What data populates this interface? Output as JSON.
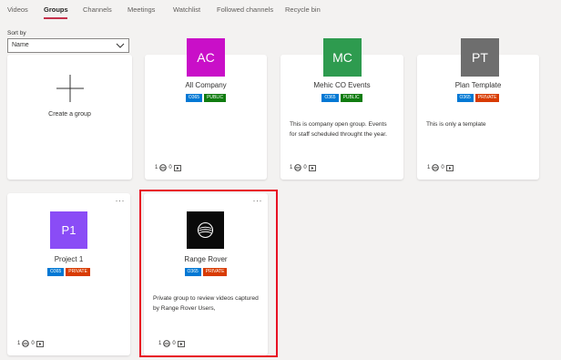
{
  "tabs": [
    "Videos",
    "Groups",
    "Channels",
    "Meetings",
    "Watchlist",
    "Followed channels",
    "Recycle bin"
  ],
  "sort": {
    "label": "Sort by",
    "value": "Name"
  },
  "create": {
    "label": "Create a group"
  },
  "groups": [
    {
      "initials": "AC",
      "name": "All Company",
      "badges": [
        "O365",
        "PUBLIC"
      ],
      "description": "",
      "members": "1",
      "videos": "0",
      "color": "#c90fc8"
    },
    {
      "initials": "MC",
      "name": "Mehic CO Events",
      "badges": [
        "O365",
        "PUBLIC"
      ],
      "description": "This is company open group. Events for staff scheduled throught the year.",
      "members": "1",
      "videos": "0",
      "color": "#2e9b4f"
    },
    {
      "initials": "PT",
      "name": "Plan Template",
      "badges": [
        "O365",
        "PRIVATE"
      ],
      "description": "This is only a template",
      "members": "1",
      "videos": "0",
      "color": "#6e6e6e"
    },
    {
      "initials": "P1",
      "name": "Project 1",
      "badges": [
        "O365",
        "PRIVATE"
      ],
      "description": "",
      "members": "1",
      "videos": "0",
      "color": "#8a4cf6",
      "more": "···"
    },
    {
      "initials": "",
      "name": "Range Rover",
      "badges": [
        "O365",
        "PRIVATE"
      ],
      "description": "Private group to review videos captured by Range Rover Users,",
      "members": "1",
      "videos": "0",
      "color": "#0a0a0a",
      "logo_icon": "range-rover-logo-icon",
      "more": "···"
    }
  ],
  "colors": {
    "accent": "#c4314b",
    "o365": "#0078d4",
    "public": "#107c10",
    "private": "#d83b01",
    "highlight": "#e81123"
  }
}
